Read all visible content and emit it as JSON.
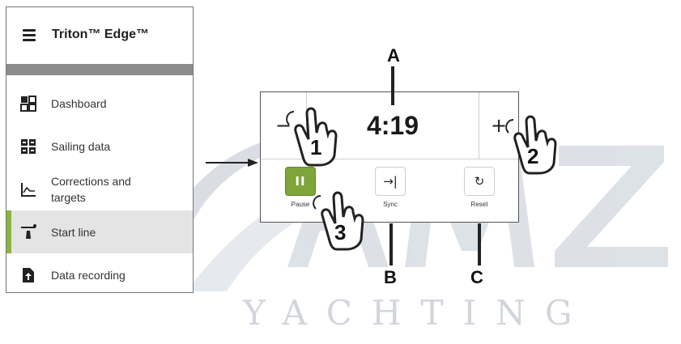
{
  "menu": {
    "app_title": "Triton™ Edge™",
    "items": [
      {
        "label": "Dashboard",
        "icon": "dashboard-icon",
        "active": false
      },
      {
        "label": "Sailing data",
        "icon": "sailing-data-icon",
        "active": false
      },
      {
        "label": "Corrections and targets",
        "icon": "corrections-chart-icon",
        "active": false
      },
      {
        "label": "Start line",
        "icon": "start-line-icon",
        "active": true
      },
      {
        "label": "Data recording",
        "icon": "data-recording-icon",
        "active": false
      }
    ]
  },
  "panel": {
    "minus_label": "−",
    "plus_label": "+",
    "timer": "4:19",
    "pause_label": "Pause",
    "pause_glyph": "II",
    "sync_label": "Sync",
    "sync_glyph": "→|",
    "reset_label": "Reset",
    "reset_glyph": "↻"
  },
  "callouts": {
    "a": "A",
    "b": "B",
    "c": "C"
  },
  "touch_markers": [
    "1",
    "2",
    "3"
  ],
  "watermark": {
    "text": "YACHTING",
    "logo_text": "AMZ"
  },
  "colors": {
    "accent_green": "#7ea43a",
    "active_bar": "#8ab43c",
    "separator_gray": "#8c8c8c",
    "watermark": "#c9ced6"
  }
}
